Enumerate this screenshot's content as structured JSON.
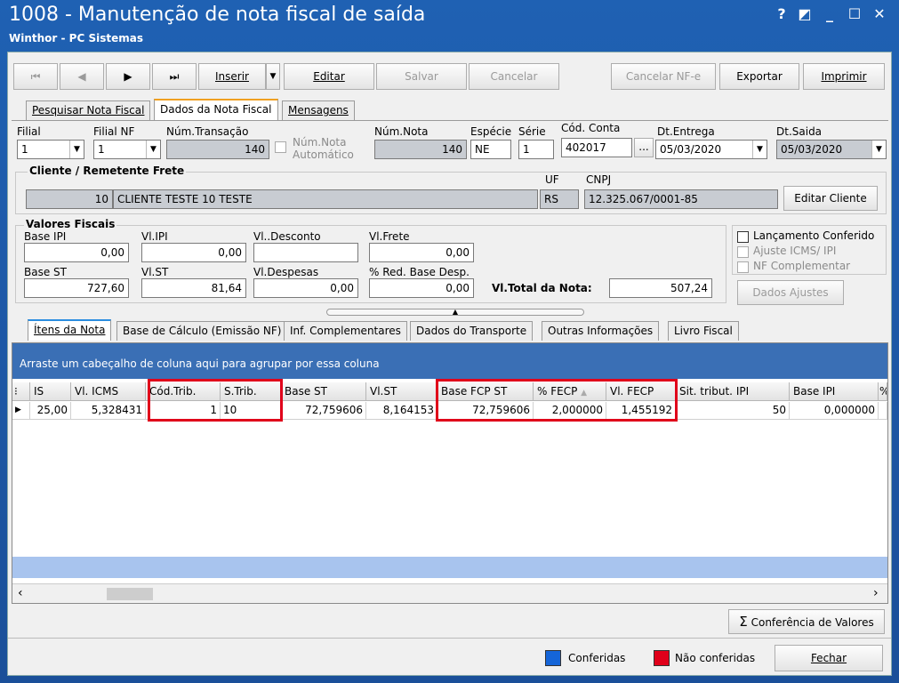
{
  "window": {
    "title": "1008 - Manutenção de nota fiscal de saída",
    "subtitle": "Winthor - PC Sistemas",
    "controls": [
      "?",
      "◩",
      "_",
      "☐",
      "✕"
    ]
  },
  "toolbar": {
    "first": "⏮",
    "prev": "◀",
    "next": "▶",
    "last": "⏭",
    "inserir": "Inserir",
    "editar": "Editar",
    "salvar": "Salvar",
    "cancelar": "Cancelar",
    "cancelar_nfe": "Cancelar NF-e",
    "exportar": "Exportar",
    "imprimir": "Imprimir"
  },
  "top_tabs": [
    "Pesquisar Nota Fiscal",
    "Dados da Nota Fiscal",
    "Mensagens"
  ],
  "header": {
    "filial_label": "Filial",
    "filial_value": "1",
    "filial_nf_label": "Filial NF",
    "filial_nf_value": "1",
    "num_transacao_label": "Núm.Transação",
    "num_transacao_value": "140",
    "num_nota_auto_label1": "Núm.Nota",
    "num_nota_auto_label2": "Automático",
    "num_nota_label": "Núm.Nota",
    "num_nota_value": "140",
    "especie_label": "Espécie",
    "especie_value": "NE",
    "serie_label": "Série",
    "serie_value": "1",
    "cod_conta_label": "Cód. Conta",
    "cod_conta_value": "402017",
    "cod_conta_btn": "...",
    "dt_entrega_label": "Dt.Entrega",
    "dt_entrega_value": "05/03/2020",
    "dt_saida_label": "Dt.Saida",
    "dt_saida_value": "05/03/2020"
  },
  "cliente": {
    "title": "Cliente / Remetente Frete",
    "codigo": "10",
    "nome": "CLIENTE TESTE 10 TESTE",
    "uf_label": "UF",
    "uf_value": "RS",
    "cnpj_label": "CNPJ",
    "cnpj_value": "12.325.067/0001-85",
    "editar_btn": "Editar Cliente"
  },
  "valores": {
    "title": "Valores Fiscais",
    "base_ipi_label": "Base IPI",
    "base_ipi": "0,00",
    "vl_ipi_label": "Vl.IPI",
    "vl_ipi": "0,00",
    "vl_desconto_label": "Vl..Desconto",
    "vl_desconto": "",
    "vl_frete_label": "Vl.Frete",
    "vl_frete": "0,00",
    "base_st_label": "Base ST",
    "base_st": "727,60",
    "vl_st_label": "Vl.ST",
    "vl_st": "81,64",
    "vl_despesas_label": "Vl.Despesas",
    "vl_despesas": "0,00",
    "red_base_label": "% Red. Base Desp.",
    "red_base": "0,00",
    "vl_total_label": "Vl.Total da Nota:",
    "vl_total": "507,24"
  },
  "checks": {
    "lancamento": "Lançamento Conferido",
    "ajuste": "Ajuste ICMS/ IPI",
    "nf_compl": "NF Complementar",
    "dados_ajustes": "Dados Ajustes"
  },
  "bottom_tabs": [
    "Ítens da Nota",
    "Base de Cálculo (Emissão NF)",
    "Inf. Complementares",
    "Dados do Transporte",
    "Outras Informações",
    "Livro Fiscal"
  ],
  "grid": {
    "group_hint": "Arraste um cabeçalho de coluna aqui para agrupar por essa coluna",
    "columns": [
      "IS",
      "Vl. ICMS",
      "Cód.Trib.",
      "S.Trib.",
      "Base ST",
      "Vl.ST",
      "Base FCP ST",
      "% FECP",
      "Vl. FECP",
      "Sit. tribut. IPI",
      "Base IPI",
      "%"
    ],
    "rows": [
      [
        "25,00",
        "5,328431",
        "1",
        "10",
        "72,759606",
        "8,164153",
        "72,759606",
        "2,000000",
        "1,455192",
        "50",
        "0,000000",
        ""
      ]
    ]
  },
  "footer": {
    "conferencia_btn": "Conferência de Valores",
    "conferidas": "Conferidas",
    "nao_conferidas": "Não conferidas",
    "fechar": "Fechar"
  },
  "colors": {
    "title_bg": "#1f61b3",
    "conferidas": "#1565d8",
    "nao_conferidas": "#e0001a",
    "highlight": "#e0001a"
  }
}
